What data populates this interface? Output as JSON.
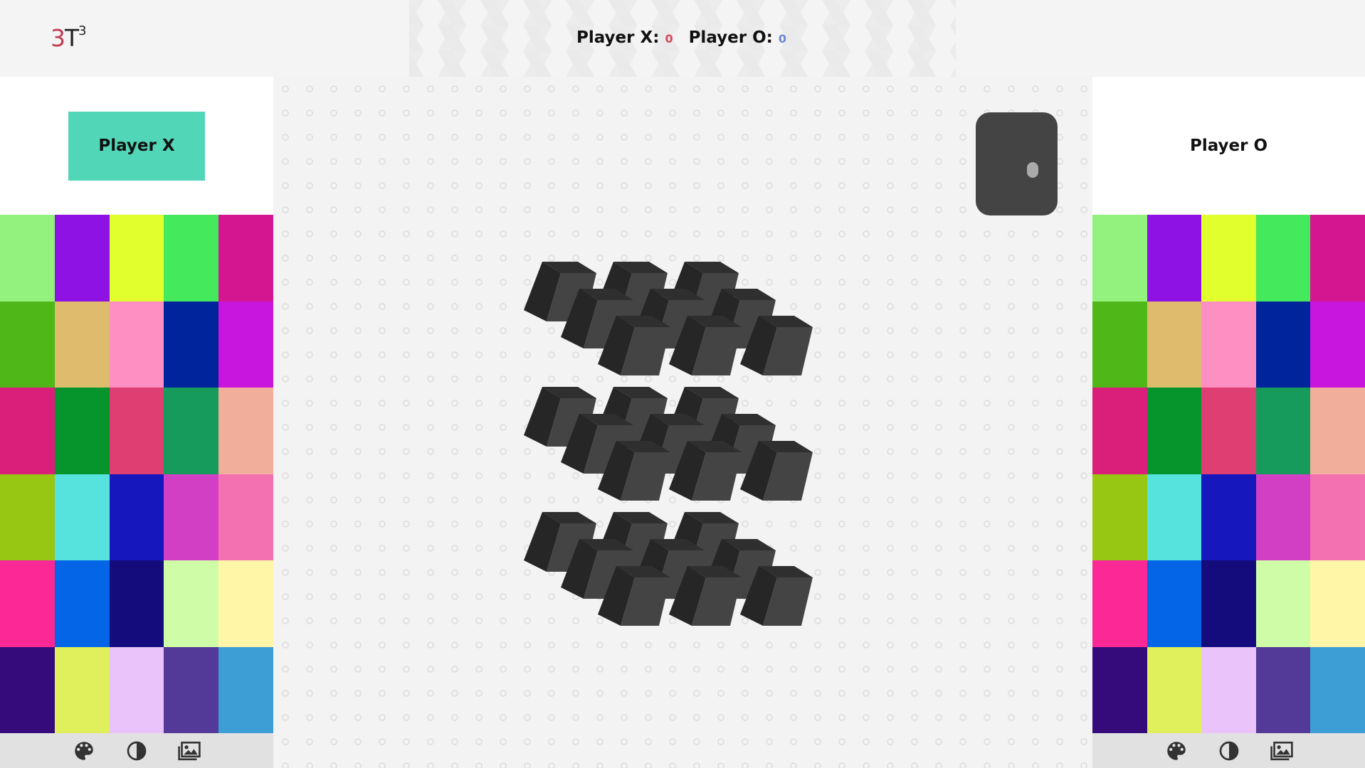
{
  "logo": {
    "digit": "3",
    "letter": "T",
    "superscript": "3"
  },
  "scoreboard": {
    "player_x_label": "Player X:",
    "player_x_score": "0",
    "player_o_label": "Player O:",
    "player_o_score": "0"
  },
  "left_panel": {
    "player_label": "Player X",
    "active": true,
    "colors": [
      "#93f27e",
      "#8e12e3",
      "#e1ff2c",
      "#45e95c",
      "#d41790",
      "#4fb718",
      "#dfbb6d",
      "#fe8fc3",
      "#00249c",
      "#c816de",
      "#d91f7a",
      "#05952c",
      "#df3e72",
      "#169b5d",
      "#f1ae9b",
      "#97c613",
      "#56e3de",
      "#1617bd",
      "#d23ec4",
      "#f371b0",
      "#fc2896",
      "#0466e6",
      "#140c7d",
      "#cffca7",
      "#fff6a7",
      "#350b7b",
      "#e0f05c",
      "#e9c3fa",
      "#533998",
      "#3d9ed6"
    ]
  },
  "right_panel": {
    "player_label": "Player O",
    "active": false,
    "colors": [
      "#93f27e",
      "#8e12e3",
      "#e1ff2c",
      "#45e95c",
      "#d41790",
      "#4fb718",
      "#dfbb6d",
      "#fe8fc3",
      "#00249c",
      "#c816de",
      "#d91f7a",
      "#05952c",
      "#df3e72",
      "#169b5d",
      "#f1ae9b",
      "#97c613",
      "#56e3de",
      "#1617bd",
      "#d23ec4",
      "#f371b0",
      "#fc2896",
      "#0466e6",
      "#140c7d",
      "#cffca7",
      "#fff6a7",
      "#350b7b",
      "#e0f05c",
      "#e9c3fa",
      "#533998",
      "#3d9ed6"
    ]
  },
  "toolbar_icons": [
    "palette-icon",
    "contrast-icon",
    "image-icon"
  ],
  "board": {
    "layers": 3,
    "rows": 3,
    "cols": 3,
    "cube_color": "#2a2a2a"
  },
  "view_toggle": {
    "state": "off"
  }
}
